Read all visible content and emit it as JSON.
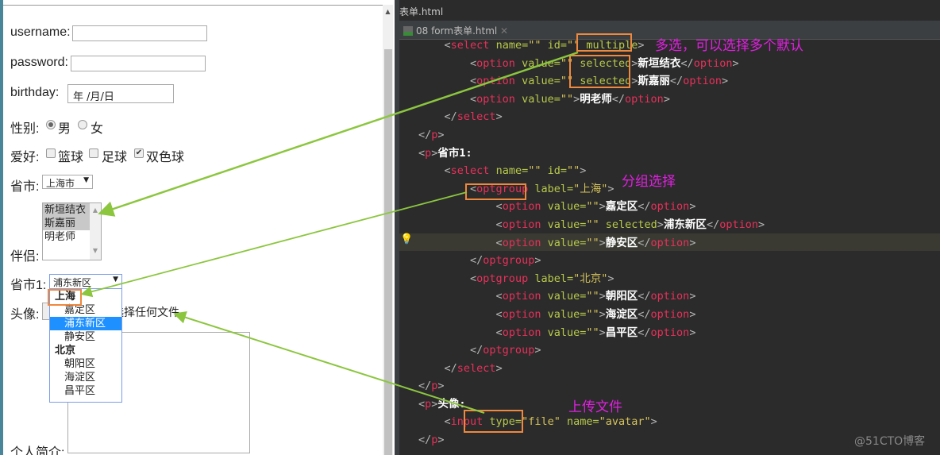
{
  "browser": {
    "username_label": "username:",
    "password_label": "password:",
    "birthday_label": "birthday:",
    "birthday_value": "年 /月/日",
    "gender_label": "性别:",
    "gender_options": [
      {
        "label": "男",
        "checked": true
      },
      {
        "label": "女",
        "checked": false
      }
    ],
    "hobby_label": "爱好:",
    "hobby_options": [
      {
        "label": "篮球",
        "checked": false
      },
      {
        "label": "足球",
        "checked": false
      },
      {
        "label": "双色球",
        "checked": true
      }
    ],
    "province_label": "省市:",
    "province_value": "上海市",
    "partner_label": "伴侣:",
    "partner_options": [
      {
        "label": "新垣结衣",
        "selected": true
      },
      {
        "label": "斯嘉丽",
        "selected": true
      },
      {
        "label": "明老师",
        "selected": false
      }
    ],
    "province1_label": "省市1:",
    "province1_value": "浦东新区",
    "province1_dropdown": [
      {
        "group": "上海",
        "options": [
          "嘉定区",
          "浦东新区",
          "静安区"
        ]
      },
      {
        "group": "北京",
        "options": [
          "朝阳区",
          "海淀区",
          "昌平区"
        ]
      }
    ],
    "avatar_label": "头像:",
    "avatar_status": "未选择任何文件",
    "bio_label": "个人简介:"
  },
  "ide": {
    "title": "表单.html",
    "tab": "08 form表单.html",
    "lines": [
      [
        [
          "    ",
          "p"
        ],
        [
          "<",
          "p"
        ],
        [
          "select",
          "tag"
        ],
        [
          " name=",
          "attr"
        ],
        [
          "\"\"",
          "str"
        ],
        [
          " id=",
          "attr"
        ],
        [
          "\"\"",
          "str"
        ],
        [
          " multiple",
          "attr"
        ],
        [
          ">",
          "p"
        ]
      ],
      [
        [
          "        ",
          "p"
        ],
        [
          "<",
          "p"
        ],
        [
          "option",
          "tag"
        ],
        [
          " value=",
          "attr"
        ],
        [
          "\"\"",
          "str"
        ],
        [
          " selected",
          "attr"
        ],
        [
          ">",
          "p"
        ],
        [
          "新垣结衣",
          "txt"
        ],
        [
          "</",
          "p"
        ],
        [
          "option",
          "tag"
        ],
        [
          ">",
          "p"
        ]
      ],
      [
        [
          "        ",
          "p"
        ],
        [
          "<",
          "p"
        ],
        [
          "option",
          "tag"
        ],
        [
          " value=",
          "attr"
        ],
        [
          "\"\"",
          "str"
        ],
        [
          " selected",
          "attr"
        ],
        [
          ">",
          "p"
        ],
        [
          "斯嘉丽",
          "txt"
        ],
        [
          "</",
          "p"
        ],
        [
          "option",
          "tag"
        ],
        [
          ">",
          "p"
        ]
      ],
      [
        [
          "        ",
          "p"
        ],
        [
          "<",
          "p"
        ],
        [
          "option",
          "tag"
        ],
        [
          " value=",
          "attr"
        ],
        [
          "\"\"",
          "str"
        ],
        [
          ">",
          "p"
        ],
        [
          "明老师",
          "txt"
        ],
        [
          "</",
          "p"
        ],
        [
          "option",
          "tag"
        ],
        [
          ">",
          "p"
        ]
      ],
      [
        [
          "    ",
          "p"
        ],
        [
          "</",
          "p"
        ],
        [
          "select",
          "tag"
        ],
        [
          ">",
          "p"
        ]
      ],
      [
        [
          "",
          "p"
        ],
        [
          "</",
          "p"
        ],
        [
          "p",
          "tag"
        ],
        [
          ">",
          "p"
        ]
      ],
      [
        [
          "",
          "p"
        ],
        [
          "<",
          "p"
        ],
        [
          "p",
          "tag"
        ],
        [
          ">",
          "p"
        ],
        [
          "省市1:",
          "txt"
        ]
      ],
      [
        [
          "    ",
          "p"
        ],
        [
          "<",
          "p"
        ],
        [
          "select",
          "tag"
        ],
        [
          " name=",
          "attr"
        ],
        [
          "\"\"",
          "str"
        ],
        [
          " id=",
          "attr"
        ],
        [
          "\"\"",
          "str"
        ],
        [
          ">",
          "p"
        ]
      ],
      [
        [
          "        ",
          "p"
        ],
        [
          "<",
          "p"
        ],
        [
          "optgroup",
          "tag"
        ],
        [
          " label=",
          "attr"
        ],
        [
          "\"上海\"",
          "str"
        ],
        [
          ">",
          "p"
        ]
      ],
      [
        [
          "            ",
          "p"
        ],
        [
          "<",
          "p"
        ],
        [
          "option",
          "tag"
        ],
        [
          " value=",
          "attr"
        ],
        [
          "\"\"",
          "str"
        ],
        [
          ">",
          "p"
        ],
        [
          "嘉定区",
          "txt"
        ],
        [
          "</",
          "p"
        ],
        [
          "option",
          "tag"
        ],
        [
          ">",
          "p"
        ]
      ],
      [
        [
          "            ",
          "p"
        ],
        [
          "<",
          "p"
        ],
        [
          "option",
          "tag"
        ],
        [
          " value=",
          "attr"
        ],
        [
          "\"\"",
          "str"
        ],
        [
          " selected",
          "attr"
        ],
        [
          ">",
          "p"
        ],
        [
          "浦东新区",
          "txt"
        ],
        [
          "</",
          "p"
        ],
        [
          "option",
          "tag"
        ],
        [
          ">",
          "p"
        ]
      ],
      [
        [
          "            ",
          "p"
        ],
        [
          "<",
          "p"
        ],
        [
          "option",
          "tag"
        ],
        [
          " value=",
          "attr"
        ],
        [
          "\"\"",
          "str"
        ],
        [
          ">",
          "p"
        ],
        [
          "静安区",
          "txt"
        ],
        [
          "</",
          "p"
        ],
        [
          "option",
          "tag"
        ],
        [
          ">",
          "p"
        ]
      ],
      [
        [
          "        ",
          "p"
        ],
        [
          "</",
          "p"
        ],
        [
          "optgroup",
          "tag"
        ],
        [
          ">",
          "p"
        ]
      ],
      [
        [
          "        ",
          "p"
        ],
        [
          "<",
          "p"
        ],
        [
          "optgroup",
          "tag"
        ],
        [
          " label=",
          "attr"
        ],
        [
          "\"北京\"",
          "str"
        ],
        [
          ">",
          "p"
        ]
      ],
      [
        [
          "            ",
          "p"
        ],
        [
          "<",
          "p"
        ],
        [
          "option",
          "tag"
        ],
        [
          " value=",
          "attr"
        ],
        [
          "\"\"",
          "str"
        ],
        [
          ">",
          "p"
        ],
        [
          "朝阳区",
          "txt"
        ],
        [
          "</",
          "p"
        ],
        [
          "option",
          "tag"
        ],
        [
          ">",
          "p"
        ]
      ],
      [
        [
          "            ",
          "p"
        ],
        [
          "<",
          "p"
        ],
        [
          "option",
          "tag"
        ],
        [
          " value=",
          "attr"
        ],
        [
          "\"\"",
          "str"
        ],
        [
          ">",
          "p"
        ],
        [
          "海淀区",
          "txt"
        ],
        [
          "</",
          "p"
        ],
        [
          "option",
          "tag"
        ],
        [
          ">",
          "p"
        ]
      ],
      [
        [
          "            ",
          "p"
        ],
        [
          "<",
          "p"
        ],
        [
          "option",
          "tag"
        ],
        [
          " value=",
          "attr"
        ],
        [
          "\"\"",
          "str"
        ],
        [
          ">",
          "p"
        ],
        [
          "昌平区",
          "txt"
        ],
        [
          "</",
          "p"
        ],
        [
          "option",
          "tag"
        ],
        [
          ">",
          "p"
        ]
      ],
      [
        [
          "        ",
          "p"
        ],
        [
          "</",
          "p"
        ],
        [
          "optgroup",
          "tag"
        ],
        [
          ">",
          "p"
        ]
      ],
      [
        [
          "    ",
          "p"
        ],
        [
          "</",
          "p"
        ],
        [
          "select",
          "tag"
        ],
        [
          ">",
          "p"
        ]
      ],
      [
        [
          "",
          "p"
        ],
        [
          "</",
          "p"
        ],
        [
          "p",
          "tag"
        ],
        [
          ">",
          "p"
        ]
      ],
      [
        [
          "",
          "p"
        ],
        [
          "<",
          "p"
        ],
        [
          "p",
          "tag"
        ],
        [
          ">",
          "p"
        ],
        [
          "头像:",
          "txt"
        ]
      ],
      [
        [
          "    ",
          "p"
        ],
        [
          "<",
          "p"
        ],
        [
          "input",
          "tag"
        ],
        [
          " type=",
          "attr"
        ],
        [
          "\"file\"",
          "str"
        ],
        [
          " name=",
          "attr"
        ],
        [
          "\"avatar\"",
          "str"
        ],
        [
          ">",
          "p"
        ]
      ],
      [
        [
          "",
          "p"
        ],
        [
          "</",
          "p"
        ],
        [
          "p",
          "tag"
        ],
        [
          ">",
          "p"
        ]
      ]
    ]
  },
  "annotations": {
    "multiple": "多选，可以选择多个默认",
    "optgroup": "分组选择",
    "file": "上传文件"
  },
  "watermark": "@51CTO博客",
  "colors": {
    "arrow": "#8cc63f",
    "highlight_box": "#f0883e",
    "annotation": "#e020e0",
    "selection": "#1e90ff"
  }
}
